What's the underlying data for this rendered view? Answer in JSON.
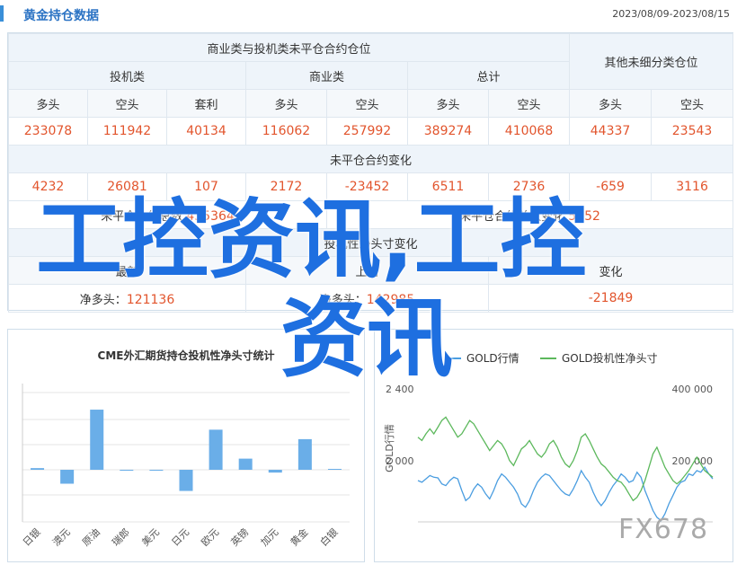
{
  "header": {
    "title": "黄金持仓数据",
    "date_range": "2023/08/09-2023/08/15"
  },
  "positions": {
    "commercial_group": "商业类与投机类未平仓合约仓位",
    "other_group": "其他未细分类仓位",
    "spec": "投机类",
    "commercial": "商业类",
    "total": "总计",
    "long": "多头",
    "short": "空头",
    "arb": "套利",
    "values": [
      "233078",
      "111942",
      "40134",
      "116062",
      "257992",
      "389274",
      "410068",
      "44337",
      "23543"
    ],
    "change_title": "未平仓合约变化",
    "changes": [
      "4232",
      "26081",
      "107",
      "2172",
      "-23452",
      "6511",
      "2736",
      "-659",
      "3116"
    ],
    "oi_label": "未平仓合约总数",
    "oi_value": "435364",
    "oi_change_label": "未平仓合约总数变化",
    "oi_change_value": "5852",
    "spec_net_title": "投机性净头寸变化",
    "latest": "最新",
    "last_week": "上周",
    "prev": "变化",
    "net_label": "净多头：",
    "net_latest": "121136",
    "net_last": "142985",
    "net_change": "-21849"
  },
  "cme_chart": {
    "title": "CME外汇期货持仓投机性净头寸统计",
    "chart_data": {
      "type": "bar",
      "categories": [
        "日银",
        "澳元",
        "原油",
        "瑞郎",
        "美元",
        "日元",
        "欧元",
        "英镑",
        "加元",
        "黄金",
        "白银"
      ],
      "values": [
        0.3,
        -2.5,
        10.8,
        -0.1,
        -0.1,
        -3.8,
        7.2,
        2.0,
        -0.5,
        5.5,
        0.0
      ],
      "grid": true
    }
  },
  "gold_chart": {
    "legend": [
      "GOLD行情",
      "GOLD投机性净头寸"
    ],
    "left_ticks": [
      "2 400",
      "2 000"
    ],
    "right_ticks": [
      "400 000",
      "200 000"
    ],
    "left_label": "GOLD行情",
    "colors": {
      "price": "#4a9de0",
      "net": "#5cb85c"
    },
    "chart_data": {
      "type": "line",
      "series": [
        {
          "name": "GOLD行情",
          "values": [
            1990,
            1985,
            1995,
            2005,
            2000,
            1998,
            1980,
            1975,
            1990,
            2000,
            1995,
            1960,
            1930,
            1940,
            1965,
            1980,
            1970,
            1950,
            1935,
            1960,
            1990,
            2010,
            2000,
            1985,
            1970,
            1950,
            1920,
            1910,
            1930,
            1960,
            1985,
            2000,
            2010,
            2005,
            1990,
            1975,
            1960,
            1950,
            1945,
            1965,
            1990,
            2020,
            2000,
            1985,
            1955,
            1930,
            1915,
            1930,
            1955,
            1975,
            1990,
            2010,
            2000,
            1985,
            1990,
            2015,
            2000,
            1960,
            1930,
            1900,
            1880,
            1870,
            1890,
            1920,
            1945,
            1970,
            1985,
            1990,
            2010,
            2005,
            2020,
            2015,
            2030,
            2010,
            1995
          ]
        },
        {
          "name": "GOLD投机性净头寸",
          "values": [
            2120,
            2110,
            2130,
            2145,
            2130,
            2150,
            2170,
            2180,
            2160,
            2140,
            2120,
            2130,
            2150,
            2170,
            2160,
            2140,
            2120,
            2100,
            2080,
            2095,
            2110,
            2100,
            2080,
            2050,
            2035,
            2060,
            2085,
            2095,
            2110,
            2090,
            2070,
            2060,
            2075,
            2100,
            2110,
            2090,
            2060,
            2040,
            2030,
            2050,
            2080,
            2120,
            2130,
            2110,
            2085,
            2060,
            2040,
            2030,
            2015,
            2000,
            1990,
            1985,
            1970,
            1950,
            1930,
            1940,
            1960,
            1990,
            2030,
            2070,
            2090,
            2060,
            2030,
            2010,
            1990,
            1980,
            1990,
            2005,
            2020,
            2040,
            2060,
            2040,
            2020,
            2010,
            2000
          ]
        }
      ]
    }
  },
  "watermark": {
    "text": "工控资讯,工控",
    "text2": "资讯",
    "site": "FX678"
  }
}
